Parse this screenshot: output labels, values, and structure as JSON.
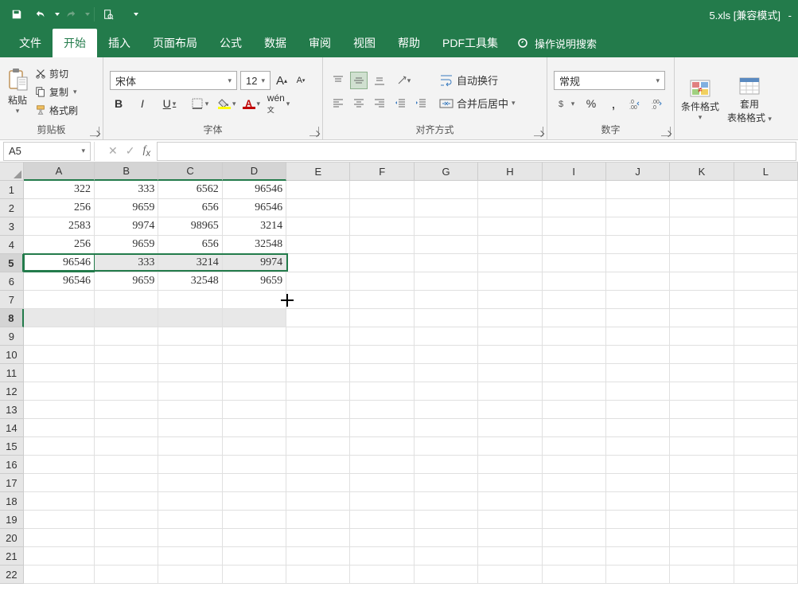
{
  "titlebar": {
    "filename": "5.xls",
    "compat_mode": "[兼容模式]",
    "dash": "-"
  },
  "menus": {
    "file": "文件",
    "home": "开始",
    "insert": "插入",
    "page_layout": "页面布局",
    "formulas": "公式",
    "data": "数据",
    "review": "审阅",
    "view": "视图",
    "help": "帮助",
    "pdf": "PDF工具集",
    "search_hint": "操作说明搜索"
  },
  "ribbon": {
    "clipboard": {
      "paste": "粘贴",
      "cut": "剪切",
      "copy": "复制",
      "format_painter": "格式刷",
      "label": "剪贴板"
    },
    "font": {
      "name": "宋体",
      "size": "12",
      "label": "字体"
    },
    "alignment": {
      "wrap_text": "自动换行",
      "merge_center": "合并后居中",
      "label": "对齐方式"
    },
    "number": {
      "format": "常规",
      "label": "数字"
    },
    "styles": {
      "cond_format": "条件格式",
      "apply_table": "套用",
      "table_format": "表格格式"
    }
  },
  "namebox": "A5",
  "columns": [
    "A",
    "B",
    "C",
    "D",
    "E",
    "F",
    "G",
    "H",
    "I",
    "J",
    "K",
    "L"
  ],
  "rows": [
    "1",
    "2",
    "3",
    "4",
    "5",
    "6",
    "7",
    "8",
    "9",
    "10",
    "11",
    "12",
    "13",
    "14",
    "15",
    "16",
    "17",
    "18",
    "19",
    "20",
    "21",
    "22"
  ],
  "col_widths": {
    "A": 90,
    "B": 81,
    "C": 81,
    "D": 81,
    "E": 81,
    "F": 81,
    "G": 81,
    "H": 81,
    "I": 81,
    "J": 81,
    "K": 81,
    "L": 81
  },
  "data": {
    "1": {
      "A": "322",
      "B": "333",
      "C": "6562",
      "D": "96546"
    },
    "2": {
      "A": "256",
      "B": "9659",
      "C": "656",
      "D": "96546"
    },
    "3": {
      "A": "2583",
      "B": "9974",
      "C": "98965",
      "D": "3214"
    },
    "4": {
      "A": "256",
      "B": "9659",
      "C": "656",
      "D": "32548"
    },
    "5": {
      "A": "96546",
      "B": "333",
      "C": "3214",
      "D": "9974"
    },
    "6": {
      "A": "96546",
      "B": "9659",
      "C": "32548",
      "D": "9659"
    }
  },
  "selection": {
    "selected_rows": [
      "5",
      "8"
    ],
    "selected_cols": [
      "A",
      "B",
      "C",
      "D"
    ],
    "active_cell": {
      "row": "5",
      "col": "A"
    }
  }
}
